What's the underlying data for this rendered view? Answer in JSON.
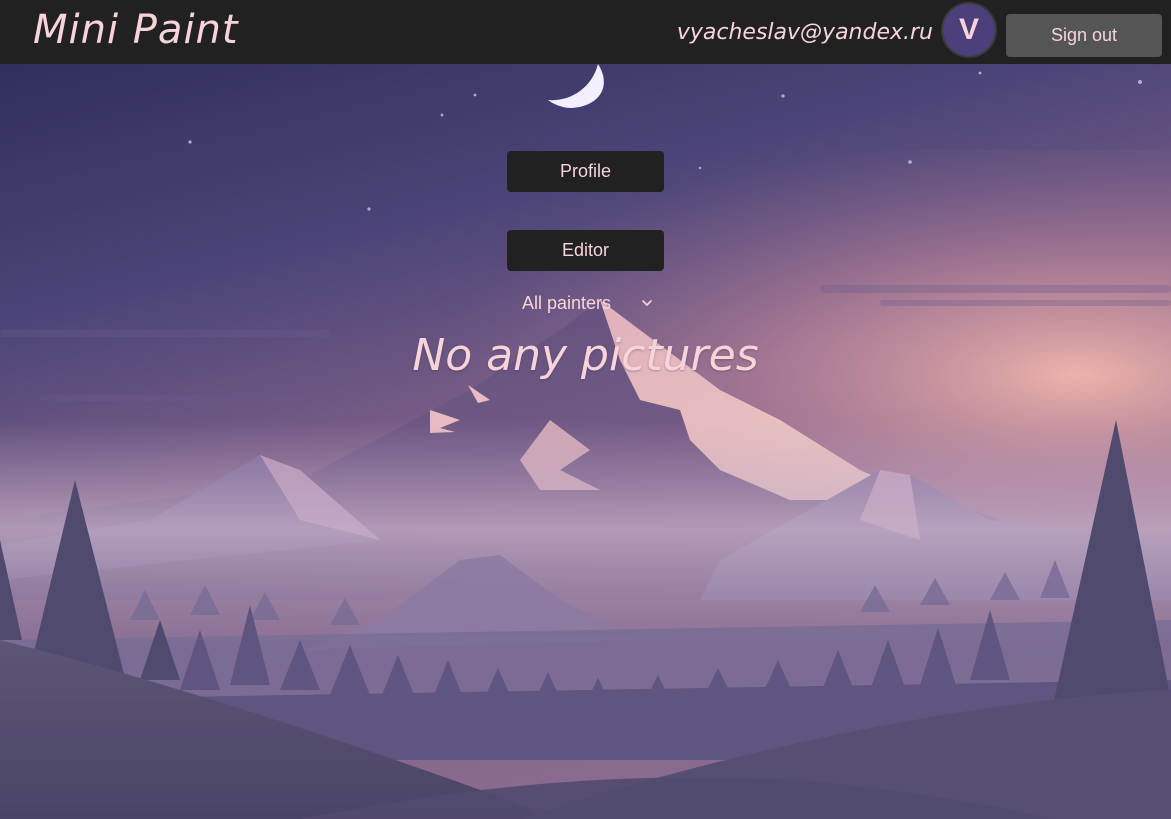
{
  "header": {
    "app_title": "Mini Paint",
    "user_email": "vyacheslav@yandex.ru",
    "avatar_letter": "V",
    "signout_label": "Sign out"
  },
  "nav": {
    "profile_label": "Profile",
    "editor_label": "Editor"
  },
  "filter": {
    "selected": "All painters",
    "icon": "chevron-down-icon"
  },
  "gallery": {
    "empty_message": "No any pictures"
  },
  "colors": {
    "topbar": "#212121",
    "text_accent": "#f6d4da",
    "avatar_bg": "#4d3f79",
    "signout_bg": "#555555",
    "nav_button_bg": "#212121"
  }
}
